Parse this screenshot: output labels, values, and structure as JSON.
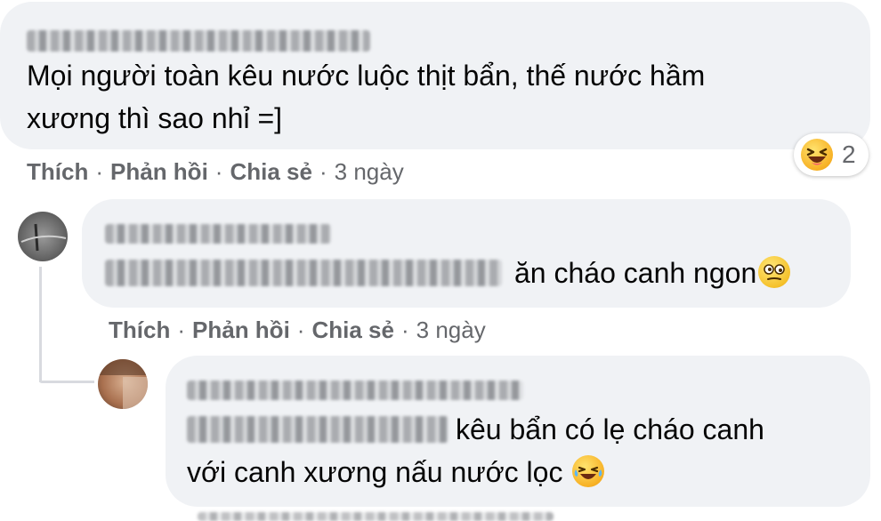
{
  "comments": [
    {
      "text_lines": [
        "Mọi người toàn kêu nước luộc thịt bẩn, thế nước hầm",
        "xương thì sao nhỉ =]"
      ],
      "actions": {
        "like": "Thích",
        "reply": "Phản hồi",
        "share": "Chia sẻ",
        "time": "3 ngày"
      },
      "reaction": {
        "icon": "laughing-emoji-icon",
        "count": "2"
      }
    },
    {
      "text": "ăn cháo canh ngon",
      "emoji": "dizzy-face-emoji-icon",
      "actions": {
        "like": "Thích",
        "reply": "Phản hồi",
        "share": "Chia sẻ",
        "time": "3 ngày"
      }
    },
    {
      "text_lines": [
        "kêu bẩn có lẹ cháo canh",
        "với canh xương nấu nước lọc"
      ],
      "emoji": "crying-laughing-emoji-icon"
    }
  ],
  "separator": "·",
  "colors": {
    "bubble_bg": "#f0f2f5",
    "action_text": "#65676b",
    "comment_text": "#050505"
  }
}
